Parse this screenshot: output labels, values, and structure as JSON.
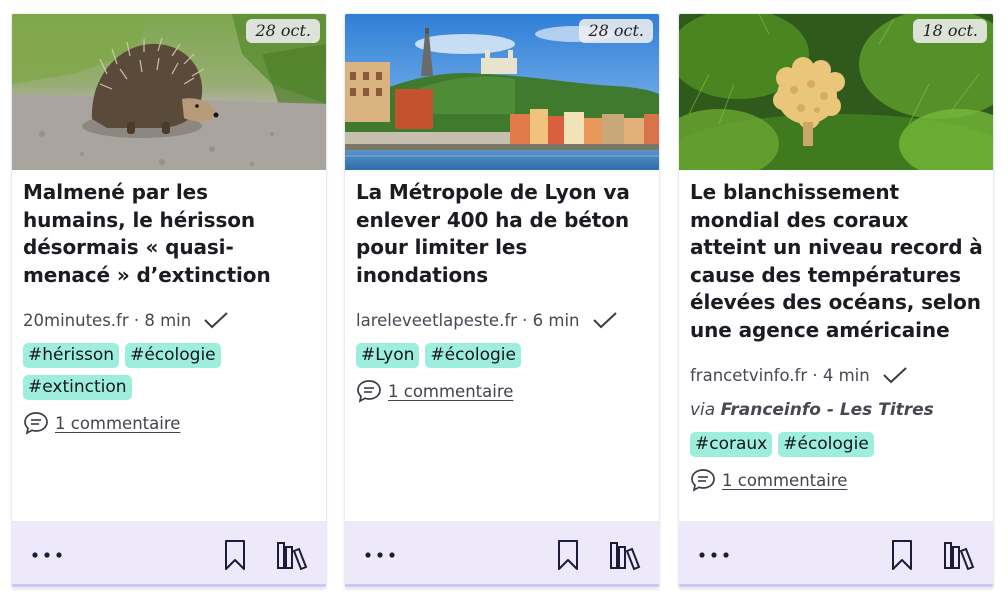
{
  "cards": [
    {
      "date": "28 oct.",
      "title": "Malmené par les humains, le hérisson désormais « quasi-menacé » d’extinction",
      "source": "20minutes.fr · 8 min",
      "tags": [
        "#hérisson",
        "#écologie",
        "#extinction"
      ],
      "comments": "1 commentaire",
      "image_icon": "hedgehog-photo"
    },
    {
      "date": "28 oct.",
      "title": "La Métropole de Lyon va enlever 400 ha de béton pour limiter les inondations",
      "source": "lareleveetlapeste.fr · 6 min",
      "tags": [
        "#Lyon",
        "#écologie"
      ],
      "comments": "1 commentaire",
      "image_icon": "lyon-city-photo"
    },
    {
      "date": "18 oct.",
      "title": "Le blanchissement mondial des coraux atteint un niveau record à cause des températures élevées des océans, selon une agence américaine",
      "source": "francetvinfo.fr · 4 min",
      "via_prefix": "via",
      "via_feed": "Franceinfo - Les Titres",
      "tags": [
        "#coraux",
        "#écologie"
      ],
      "comments": "1 commentaire",
      "image_icon": "coral-fungus-photo"
    }
  ],
  "icons": {
    "read": "check-icon",
    "comments": "comment-bubble-icon",
    "more": "more-dots-icon",
    "bookmark": "bookmark-icon",
    "library": "library-icon"
  },
  "colors": {
    "tag_bg": "#9deedd",
    "footer_bg": "#ede9fb",
    "footer_border": "#cfc5f2"
  }
}
